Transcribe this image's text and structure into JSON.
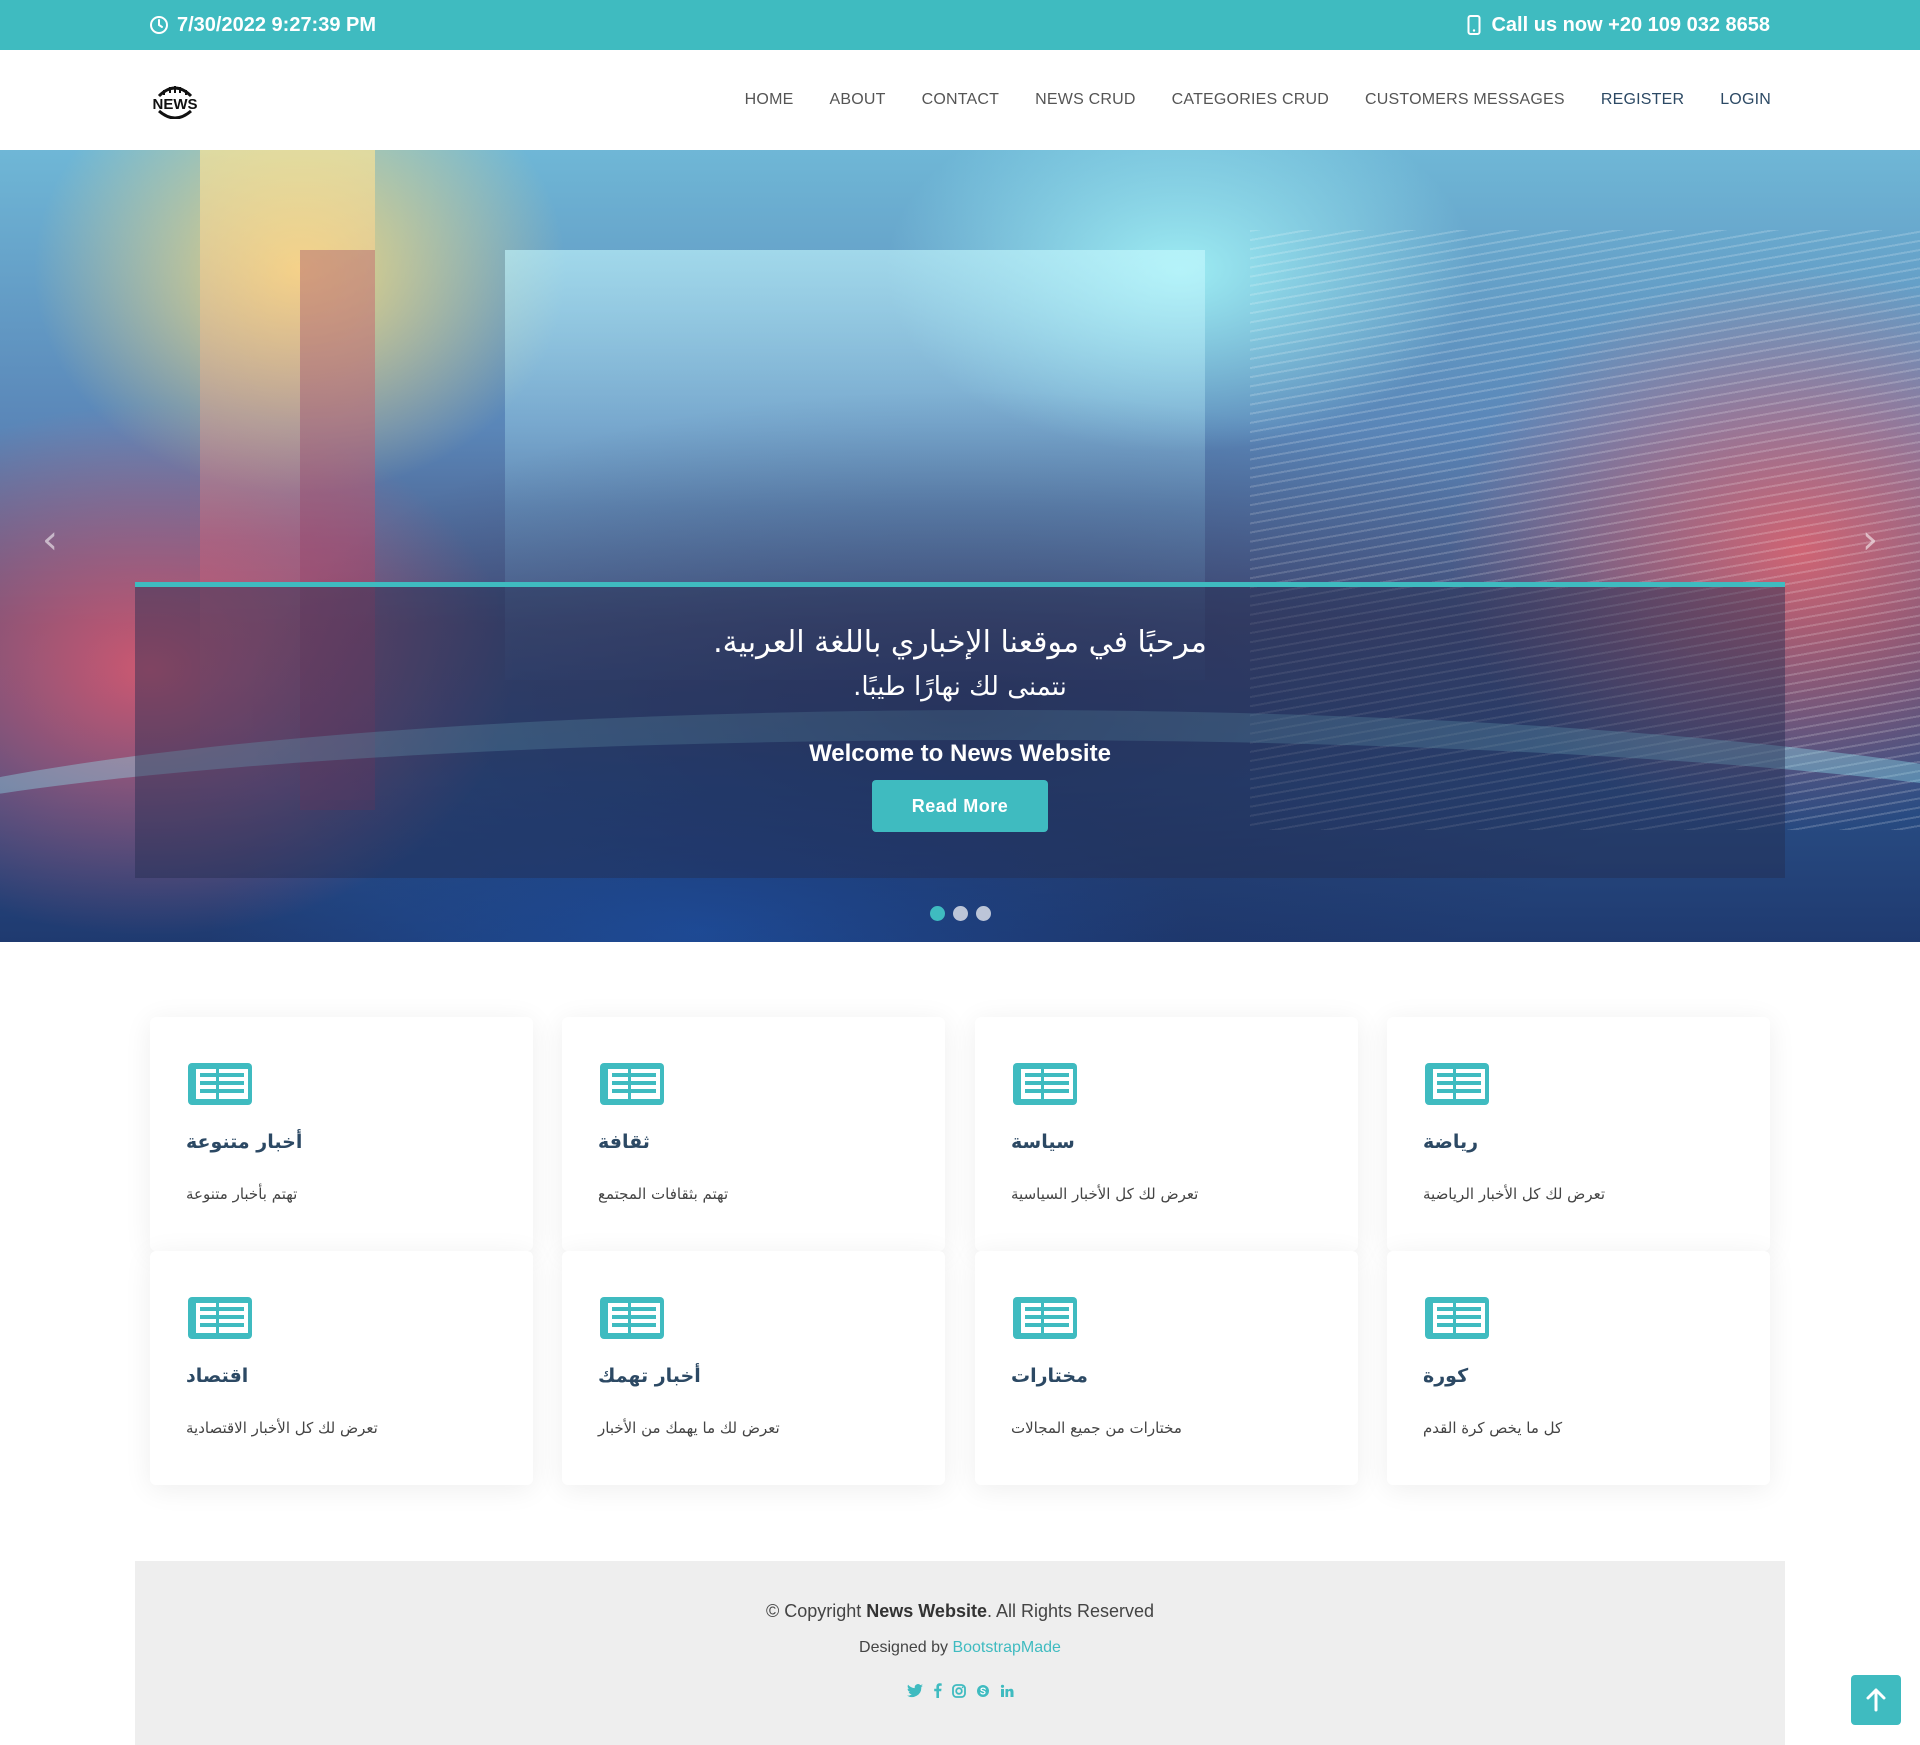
{
  "topbar": {
    "datetime": "7/30/2022 9:27:39 PM",
    "phone": "Call us now +20 109 032 8658",
    "clock_icon": "clock-icon",
    "phone_icon": "phone-icon"
  },
  "header": {
    "logo_text": "NEWS",
    "nav": [
      {
        "label": "HOME"
      },
      {
        "label": "ABOUT"
      },
      {
        "label": "CONTACT"
      },
      {
        "label": "NEWS CRUD"
      },
      {
        "label": "CATEGORIES CRUD"
      },
      {
        "label": "CUSTOMERS MESSAGES"
      },
      {
        "label": "REGISTER"
      },
      {
        "label": "LOGIN"
      }
    ]
  },
  "hero": {
    "arabic_line1": "مرحبًا في موقعنا الإخباري باللغة العربية.",
    "arabic_line2": "نتمنى لك نهارًا طيبًا.",
    "welcome": "Welcome to News Website",
    "button": "Read More",
    "prev_icon": "‹",
    "next_icon": "›",
    "slides_count": 3,
    "active_slide": 1
  },
  "cards": [
    {
      "title": "أخبار متنوعة",
      "desc": "تهتم بأخبار متنوعة"
    },
    {
      "title": "ثقافة",
      "desc": "تهتم بثقافات المجتمع"
    },
    {
      "title": "سياسة",
      "desc": "تعرض لك كل الأخبار السياسية"
    },
    {
      "title": "رياضة",
      "desc": "تعرض لك كل الأخبار الرياضية"
    },
    {
      "title": "اقتصاد",
      "desc": "تعرض لك كل الأخبار الاقتصادية"
    },
    {
      "title": "أخبار تهمك",
      "desc": "تعرض لك ما يهمك من الأخبار"
    },
    {
      "title": "مختارات",
      "desc": "مختارات من جميع المجالات"
    },
    {
      "title": "كورة",
      "desc": "كل ما يخص كرة القدم"
    }
  ],
  "footer": {
    "copy_prefix": "© Copyright ",
    "copy_brand": "News Website",
    "copy_suffix": ". All Rights Reserved",
    "designed_prefix": "Designed by ",
    "designed_link": "BootstrapMade",
    "social": [
      "twitter-icon",
      "facebook-icon",
      "instagram-icon",
      "skype-icon",
      "linkedin-icon"
    ]
  },
  "colors": {
    "accent": "#3fbbc0",
    "nav_text": "#555555",
    "title_text": "#2c4964",
    "footer_bg": "#eeeeee"
  }
}
